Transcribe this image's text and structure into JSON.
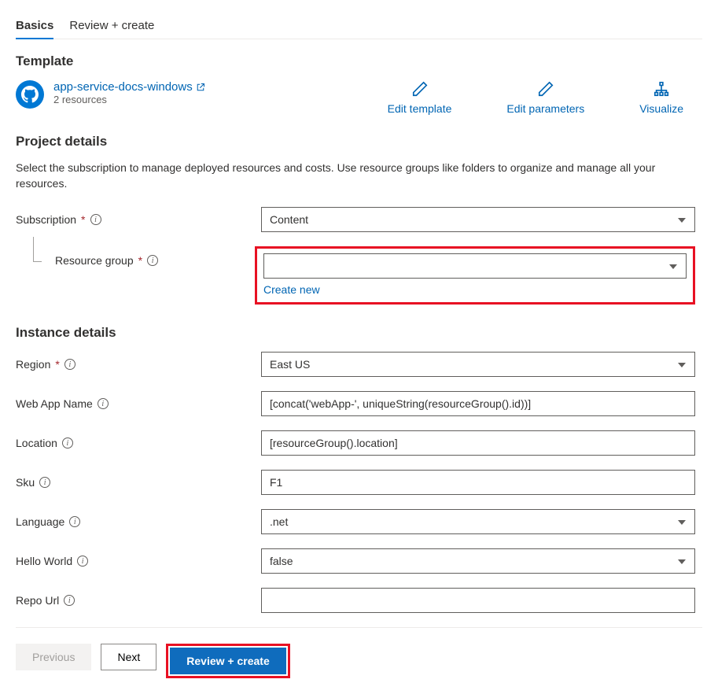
{
  "tabs": {
    "basics": "Basics",
    "review": "Review + create"
  },
  "template": {
    "heading": "Template",
    "link_text": "app-service-docs-windows",
    "resources": "2 resources",
    "actions": {
      "edit_template": "Edit template",
      "edit_parameters": "Edit parameters",
      "visualize": "Visualize"
    }
  },
  "project": {
    "heading": "Project details",
    "description": "Select the subscription to manage deployed resources and costs. Use resource groups like folders to organize and manage all your resources.",
    "subscription_label": "Subscription",
    "subscription_value": "Content",
    "resource_group_label": "Resource group",
    "resource_group_value": "",
    "create_new": "Create new"
  },
  "instance": {
    "heading": "Instance details",
    "region_label": "Region",
    "region_value": "East US",
    "webapp_label": "Web App Name",
    "webapp_value": "[concat('webApp-', uniqueString(resourceGroup().id))]",
    "location_label": "Location",
    "location_value": "[resourceGroup().location]",
    "sku_label": "Sku",
    "sku_value": "F1",
    "language_label": "Language",
    "language_value": ".net",
    "hello_label": "Hello World",
    "hello_value": "false",
    "repo_label": "Repo Url",
    "repo_value": ""
  },
  "footer": {
    "previous": "Previous",
    "next": "Next",
    "review": "Review + create"
  }
}
